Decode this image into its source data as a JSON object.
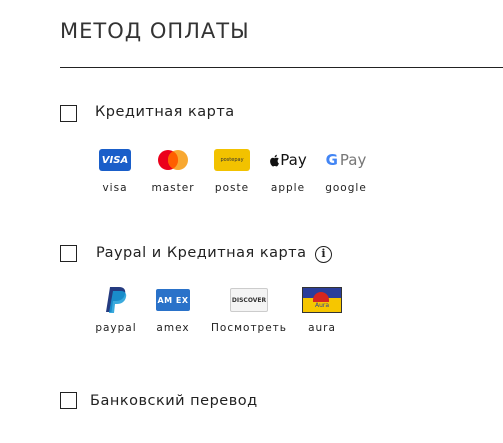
{
  "header": {
    "title": "МЕТОД ОПЛАТЫ"
  },
  "options": [
    {
      "label": "Кредитная карта",
      "methods": [
        {
          "name": "visa",
          "logo_text": "VISA",
          "icon": "visa-logo-icon"
        },
        {
          "name": "master",
          "icon": "mastercard-logo-icon"
        },
        {
          "name": "poste",
          "logo_text": "postepay",
          "icon": "postepay-logo-icon"
        },
        {
          "name": "apple",
          "logo_text": "Pay",
          "icon": "apple-pay-logo-icon"
        },
        {
          "name": "google",
          "logo_text": "Pay",
          "icon": "google-pay-logo-icon"
        }
      ]
    },
    {
      "label": "Paypal и Кредитная карта",
      "info_icon_text": "i",
      "methods": [
        {
          "name": "paypal",
          "icon": "paypal-logo-icon"
        },
        {
          "name": "amex",
          "logo_text": "AM EX",
          "icon": "amex-logo-icon"
        },
        {
          "name": "Посмотреть",
          "logo_text": "DISCOVER",
          "icon": "discover-logo-icon"
        },
        {
          "name": "aura",
          "logo_text": "Aura",
          "icon": "aura-logo-icon"
        }
      ]
    },
    {
      "label": "Банковский перевод"
    }
  ],
  "colors": {
    "visa": "#1a5ec9",
    "mastercard_red": "#eb001b",
    "mastercard_orange": "#f79e1b",
    "postepay": "#f2c200",
    "paypal_dark": "#253b80",
    "paypal_light": "#179bd7",
    "amex": "#2a72c9"
  }
}
